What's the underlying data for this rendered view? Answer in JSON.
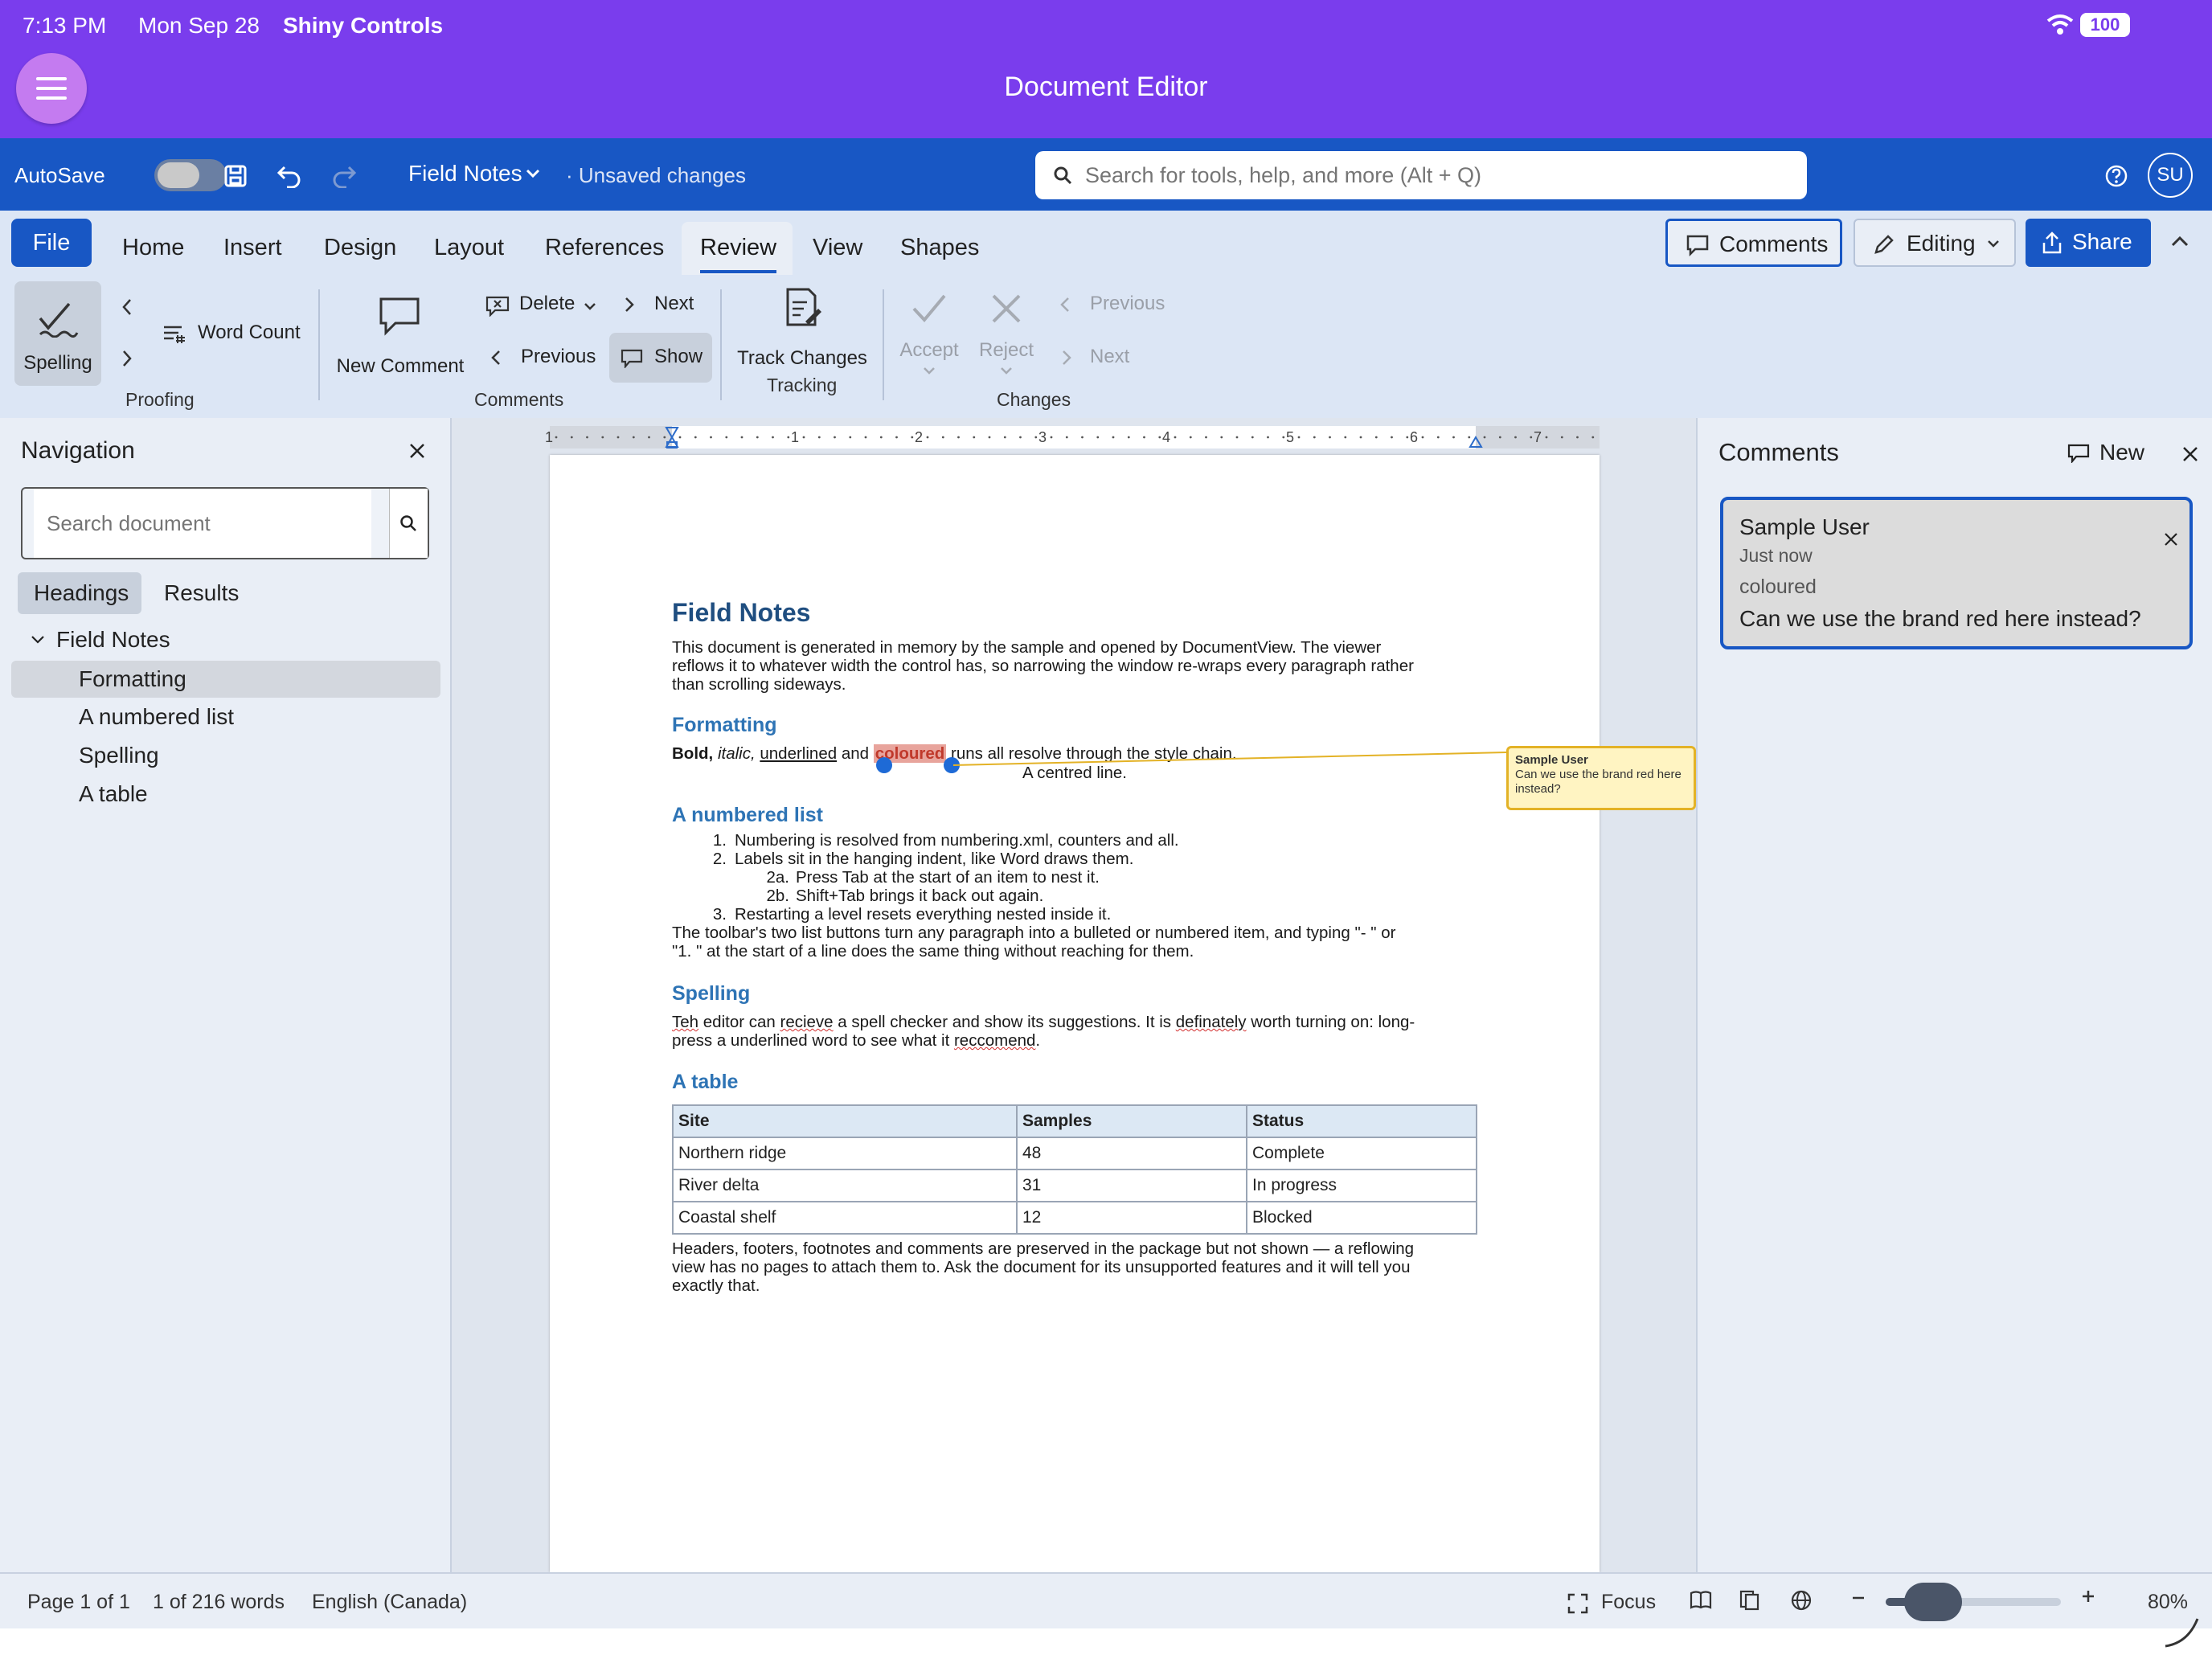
{
  "statusbar": {
    "time": "7:13 PM",
    "date": "Mon Sep 28",
    "app_name": "Shiny Controls",
    "battery": "100"
  },
  "app": {
    "title": "Document Editor"
  },
  "toolbar": {
    "autosave_label": "AutoSave",
    "autosave_on": false,
    "document_name": "Field Notes",
    "unsaved_status": "· Unsaved changes",
    "search_placeholder": "Search for tools, help, and more (Alt + Q)",
    "user_initials": "SU"
  },
  "tabs": [
    {
      "label": "File"
    },
    {
      "label": "Home"
    },
    {
      "label": "Insert"
    },
    {
      "label": "Design"
    },
    {
      "label": "Layout"
    },
    {
      "label": "References"
    },
    {
      "label": "Review",
      "active": true
    },
    {
      "label": "View"
    },
    {
      "label": "Shapes"
    }
  ],
  "header_buttons": {
    "comments": "Comments",
    "editing": "Editing",
    "share": "Share"
  },
  "ribbon": {
    "proofing": {
      "spelling": "Spelling",
      "word_count": "Word Count",
      "group": "Proofing"
    },
    "comments": {
      "new_comment": "New Comment",
      "delete": "Delete",
      "next": "Next",
      "previous": "Previous",
      "show": "Show",
      "group": "Comments"
    },
    "tracking": {
      "track_changes": "Track Changes",
      "group": "Tracking"
    },
    "changes": {
      "accept": "Accept",
      "reject": "Reject",
      "previous": "Previous",
      "next": "Next",
      "group": "Changes"
    }
  },
  "navigation": {
    "title": "Navigation",
    "search_placeholder": "Search document",
    "tabs": [
      "Headings",
      "Results"
    ],
    "root": "Field Notes",
    "items": [
      "Formatting",
      "A numbered list",
      "Spelling",
      "A table"
    ],
    "selected": "Formatting"
  },
  "document": {
    "title": "Field Notes",
    "intro": [
      "This document is generated in memory by the sample and opened by DocumentView. The viewer",
      "reflows it to whatever width the control has, so narrowing the window re-wraps every paragraph rather",
      "than scrolling sideways."
    ],
    "h_formatting": "Formatting",
    "fmt_bold": "Bold,",
    "fmt_italic": "italic,",
    "fmt_underlined": "underlined",
    "fmt_and": "and",
    "fmt_coloured": "coloured",
    "fmt_rest": "runs all resolve through the style chain.",
    "centred": "A centred line.",
    "h_list": "A numbered list",
    "list": [
      {
        "num": "1.",
        "text": "Numbering is resolved from numbering.xml, counters and all."
      },
      {
        "num": "2.",
        "text": "Labels sit in the hanging indent, like Word draws them."
      },
      {
        "num": "2a.",
        "text": "Press Tab at the start of an item to nest it."
      },
      {
        "num": "2b.",
        "text": "Shift+Tab brings it back out again."
      },
      {
        "num": "3.",
        "text": "Restarting a level resets everything nested inside it."
      }
    ],
    "list_para": [
      "The toolbar's two list buttons turn any paragraph into a bulleted or numbered item, and typing \"- \" or",
      "\"1. \" at the start of a line does the same thing without reaching for them."
    ],
    "h_spelling": "Spelling",
    "sp_teh": "Teh",
    "sp_1": "editor can",
    "sp_recieve": "recieve",
    "sp_2": "a spell checker and show its suggestions. It is",
    "sp_definately": "definately",
    "sp_3": "worth turning on: long-",
    "sp_4": "press a underlined word to see what it",
    "sp_reccomend": "reccomend",
    "sp_5": ".",
    "h_table": "A table",
    "table": {
      "headers": [
        "Site",
        "Samples",
        "Status"
      ],
      "rows": [
        [
          "Northern ridge",
          "48",
          "Complete"
        ],
        [
          "River delta",
          "31",
          "In progress"
        ],
        [
          "Coastal shelf",
          "12",
          "Blocked"
        ]
      ]
    },
    "outro": [
      "Headers, footers, footnotes and comments are preserved in the package but not shown — a reflowing",
      "view has no pages to attach them to. Ask the document for its unsupported features and it will tell you",
      "exactly that."
    ],
    "ruler_numbers": [
      "1",
      "1",
      "2",
      "3",
      "4",
      "5",
      "6",
      "7"
    ]
  },
  "balloon": {
    "author": "Sample User",
    "text": "Can we use the brand red here instead?"
  },
  "comments_pane": {
    "title": "Comments",
    "new_label": "New",
    "card": {
      "author": "Sample User",
      "time": "Just now",
      "quote": "coloured",
      "text": "Can we use the brand red here instead?"
    }
  },
  "status": {
    "page": "Page 1 of 1",
    "words": "1 of 216 words",
    "language": "English (Canada)",
    "focus": "Focus",
    "zoom": "80%",
    "zoom_fraction": 0.27
  },
  "colors": {
    "titlebar": "#7a3ded",
    "toolbar": "#1857c4",
    "ribbon": "#dce6f5",
    "heading": "#2e74b5",
    "title": "#1f4e80",
    "highlight": "#e8a49c",
    "coloured_text": "#c0392b",
    "balloon": "#fff4c2",
    "balloon_border": "#e3b226"
  }
}
